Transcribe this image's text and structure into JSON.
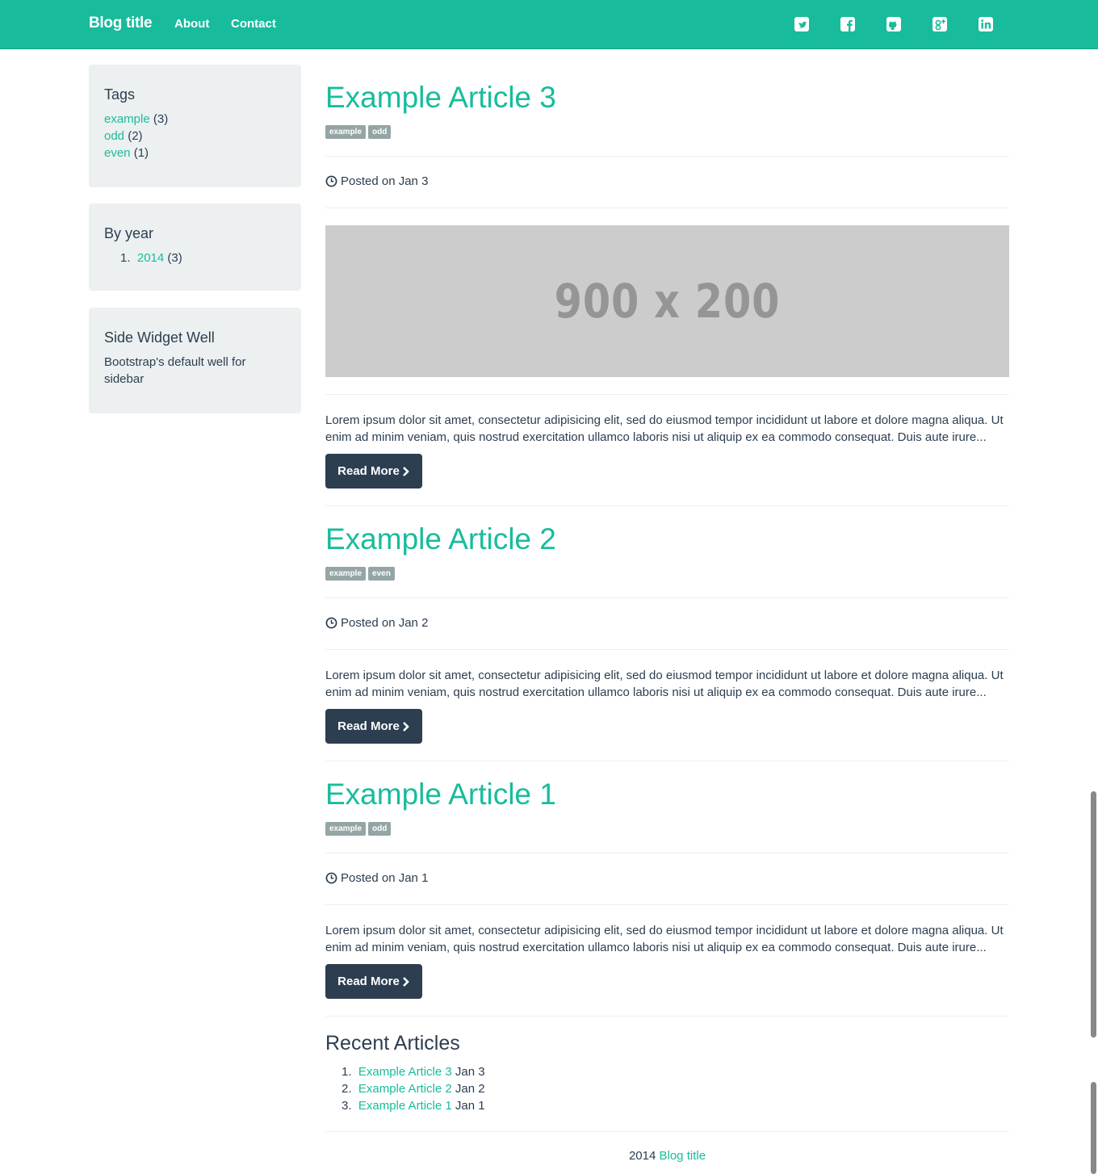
{
  "navbar": {
    "brand": "Blog title",
    "links": [
      "About",
      "Contact"
    ],
    "social_icons": [
      "twitter-icon",
      "facebook-icon",
      "github-icon",
      "google-plus-icon",
      "linkedin-icon"
    ]
  },
  "sidebar": {
    "tags": {
      "title": "Tags",
      "items": [
        {
          "name": "example",
          "count": "(3)"
        },
        {
          "name": "odd",
          "count": "(2)"
        },
        {
          "name": "even",
          "count": "(1)"
        }
      ]
    },
    "by_year": {
      "title": "By year",
      "items": [
        {
          "num": "1.",
          "year": "2014",
          "count": "(3)"
        }
      ]
    },
    "widget": {
      "title": "Side Widget Well",
      "text": "Bootstrap's default well for sidebar"
    }
  },
  "placeholder_text": "900 x 200",
  "articles": [
    {
      "title": "Example Article 3",
      "tags": [
        "example",
        "odd"
      ],
      "posted": "Posted on Jan 3",
      "excerpt": "Lorem ipsum dolor sit amet, consectetur adipisicing elit, sed do eiusmod tempor incididunt ut labore et dolore magna aliqua. Ut enim ad minim veniam, quis nostrud exercitation ullamco laboris nisi ut aliquip ex ea commodo consequat. Duis aute irure...",
      "button": "Read More"
    },
    {
      "title": "Example Article 2",
      "tags": [
        "example",
        "even"
      ],
      "posted": "Posted on Jan 2",
      "excerpt": "Lorem ipsum dolor sit amet, consectetur adipisicing elit, sed do eiusmod tempor incididunt ut labore et dolore magna aliqua. Ut enim ad minim veniam, quis nostrud exercitation ullamco laboris nisi ut aliquip ex ea commodo consequat. Duis aute irure...",
      "button": "Read More"
    },
    {
      "title": "Example Article 1",
      "tags": [
        "example",
        "odd"
      ],
      "posted": "Posted on Jan 1",
      "excerpt": "Lorem ipsum dolor sit amet, consectetur adipisicing elit, sed do eiusmod tempor incididunt ut labore et dolore magna aliqua. Ut enim ad minim veniam, quis nostrud exercitation ullamco laboris nisi ut aliquip ex ea commodo consequat. Duis aute irure...",
      "button": "Read More"
    }
  ],
  "recent": {
    "title": "Recent Articles",
    "items": [
      {
        "num": "1.",
        "title": "Example Article 3",
        "date": "Jan 3"
      },
      {
        "num": "2.",
        "title": "Example Article 2",
        "date": "Jan 2"
      },
      {
        "num": "3.",
        "title": "Example Article 1",
        "date": "Jan 1"
      }
    ]
  },
  "footer": {
    "year": "2014",
    "link": "Blog title"
  },
  "colors": {
    "accent": "#18bc9c",
    "dark": "#2c3e50",
    "well": "#ecf0f1",
    "tag": "#95a5a6"
  }
}
